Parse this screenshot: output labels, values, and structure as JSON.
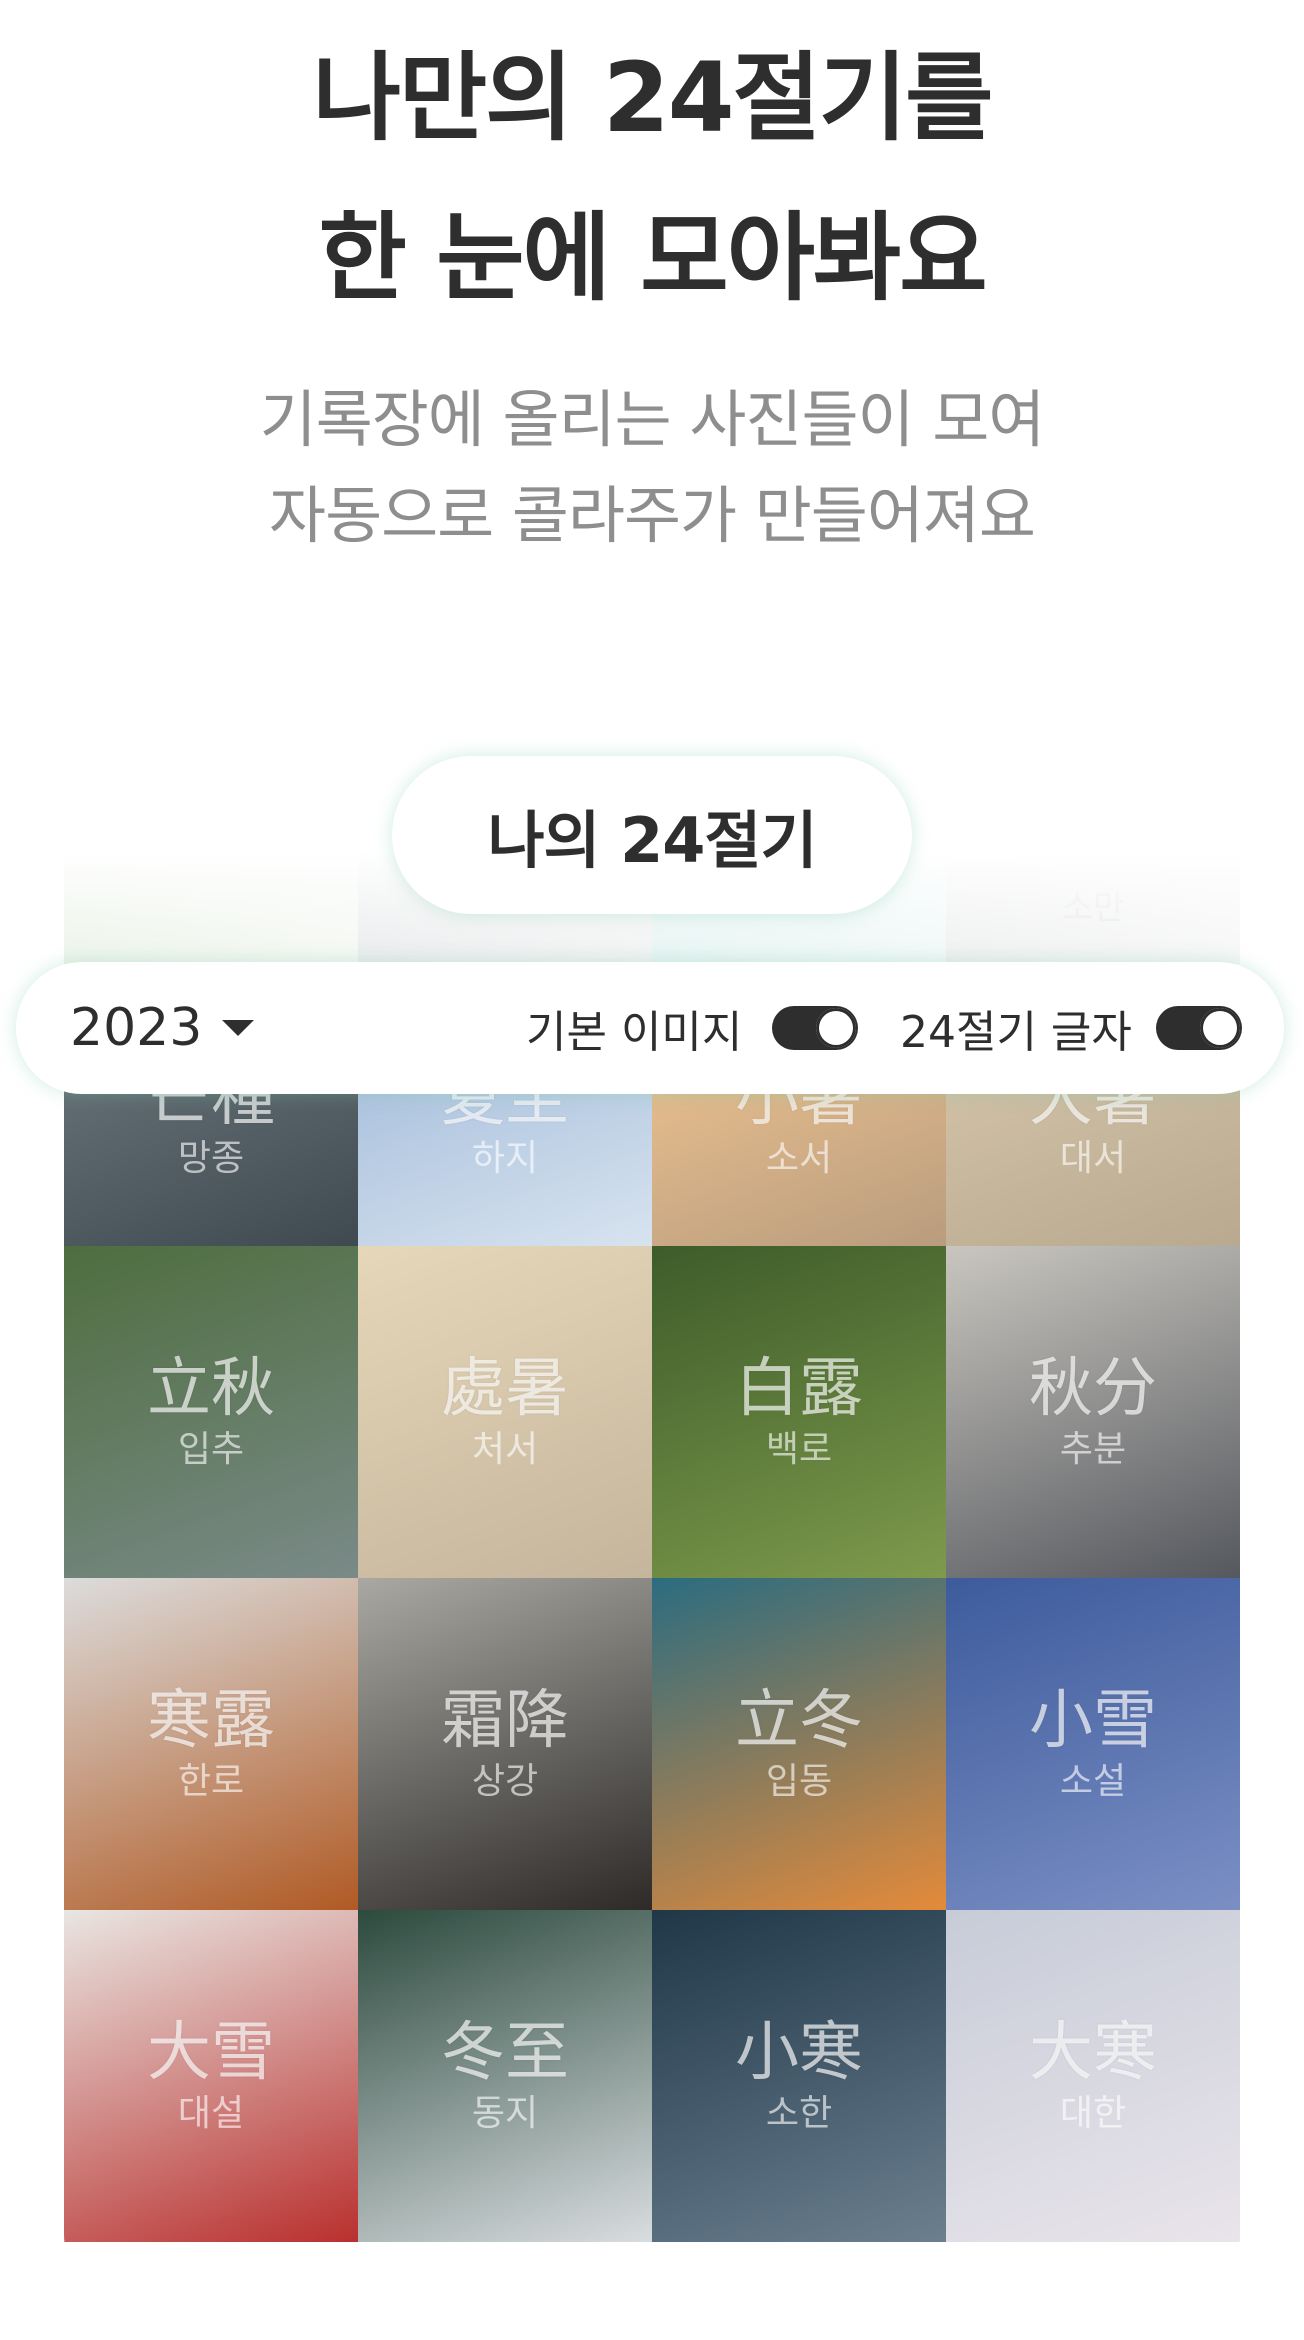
{
  "headline": {
    "line1": "나만의 24절기를",
    "line2": "한 눈에 모아봐요"
  },
  "subtitle": {
    "line1": "기록장에 올리는 사진들이 모여",
    "line2": "자동으로 콜라주가 만들어져요"
  },
  "my_button_label": "나의 24절기",
  "ghost_row": [
    "",
    "",
    "",
    "소만"
  ],
  "controls": {
    "year": "2023",
    "default_image_label": "기본 이미지",
    "default_image_on": true,
    "term_text_label": "24절기 글자",
    "term_text_on": true
  },
  "terms": [
    {
      "hanja": "芒種",
      "hangul": "망종",
      "colors": [
        "#6f7a80",
        "#3f4a50"
      ]
    },
    {
      "hanja": "夏至",
      "hangul": "하지",
      "colors": [
        "#9db7d8",
        "#d7e3ef"
      ]
    },
    {
      "hanja": "小暑",
      "hangul": "소서",
      "colors": [
        "#f3c792",
        "#b99c7e"
      ]
    },
    {
      "hanja": "大暑",
      "hangul": "대서",
      "colors": [
        "#d9c8ad",
        "#b8a98f"
      ]
    },
    {
      "hanja": "立秋",
      "hangul": "입추",
      "colors": [
        "#4e6e3f",
        "#7a8a88"
      ]
    },
    {
      "hanja": "處暑",
      "hangul": "처서",
      "colors": [
        "#e7d7b9",
        "#c4b59c"
      ]
    },
    {
      "hanja": "白露",
      "hangul": "백로",
      "colors": [
        "#3d5c2a",
        "#7e9a4c"
      ]
    },
    {
      "hanja": "秋分",
      "hangul": "추분",
      "colors": [
        "#c9c6bf",
        "#55585e"
      ]
    },
    {
      "hanja": "寒露",
      "hangul": "한로",
      "colors": [
        "#dcdcdc",
        "#b05a24"
      ]
    },
    {
      "hanja": "霜降",
      "hangul": "상강",
      "colors": [
        "#a9a8a2",
        "#2d2a28"
      ]
    },
    {
      "hanja": "立冬",
      "hangul": "입동",
      "colors": [
        "#2b6c80",
        "#e48a3a"
      ]
    },
    {
      "hanja": "小雪",
      "hangul": "소설",
      "colors": [
        "#3d5b9c",
        "#7b8fc4"
      ]
    },
    {
      "hanja": "大雪",
      "hangul": "대설",
      "colors": [
        "#e9e6e2",
        "#b9302e"
      ]
    },
    {
      "hanja": "冬至",
      "hangul": "동지",
      "colors": [
        "#2c4a3e",
        "#d9dde0"
      ]
    },
    {
      "hanja": "小寒",
      "hangul": "소한",
      "colors": [
        "#1f3747",
        "#6b7f8f"
      ]
    },
    {
      "hanja": "大寒",
      "hangul": "대한",
      "colors": [
        "#c7ccd8",
        "#e9e4ea"
      ]
    }
  ]
}
